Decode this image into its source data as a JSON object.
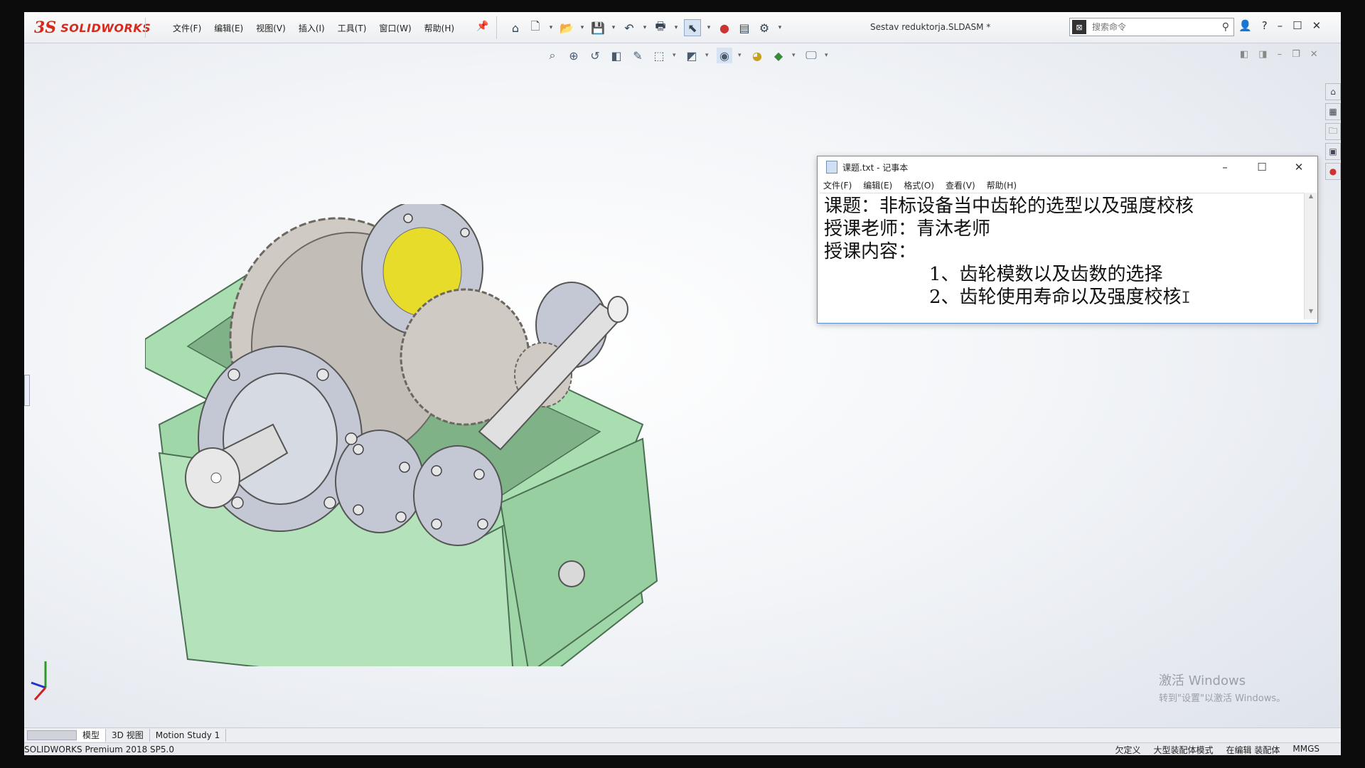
{
  "app": {
    "logo_prefix": "3S",
    "logo_name": "SOLIDWORKS",
    "document_title": "Sestav reduktorja.SLDASM *"
  },
  "menu": [
    "文件(F)",
    "编辑(E)",
    "视图(V)",
    "插入(I)",
    "工具(T)",
    "窗口(W)",
    "帮助(H)"
  ],
  "search": {
    "placeholder": "搜索命令"
  },
  "bottom_tabs": [
    "模型",
    "3D 视图",
    "Motion Study 1"
  ],
  "status": {
    "product": "SOLIDWORKS Premium 2018 SP5.0",
    "items": [
      "欠定义",
      "大型装配体模式",
      "在编辑 装配体",
      "MMGS"
    ]
  },
  "notepad": {
    "title": "课题.txt - 记事本",
    "menu": [
      "文件(F)",
      "编辑(E)",
      "格式(O)",
      "查看(V)",
      "帮助(H)"
    ],
    "lines": [
      "课题：非标设备当中齿轮的选型以及强度校核",
      "授课老师：青沐老师",
      "授课内容：",
      "1、齿轮模数以及齿数的选择",
      "2、齿轮使用寿命以及强度校核"
    ]
  },
  "watermark": {
    "line1": "激活 Windows",
    "line2": "转到\"设置\"以激活 Windows。"
  },
  "colors": {
    "gearbox_green": "#a9dfb0",
    "gear_gray": "#cfcac4",
    "bearing_yellow": "#f2e100",
    "logo_red": "#d52b1e"
  }
}
